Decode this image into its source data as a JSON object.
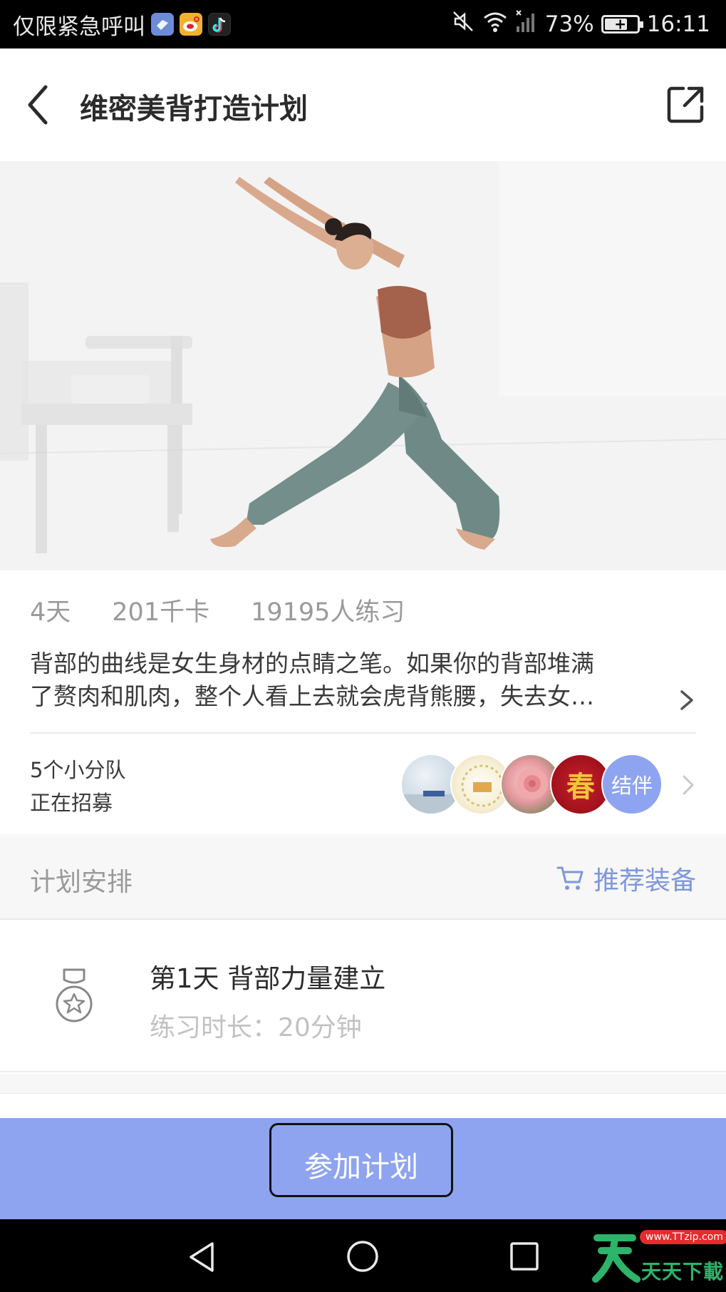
{
  "status_bar": {
    "carrier_text": "仅限紧急呼叫",
    "battery_percent": "73%",
    "battery_level": 0.73,
    "time": "16:11",
    "icons": [
      "blue-app-icon",
      "weibo-icon",
      "tiktok-icon",
      "mute-icon",
      "wifi-icon",
      "signal-icon",
      "battery-icon"
    ]
  },
  "header": {
    "title": "维密美背打造计划",
    "back_icon": "chevron-left-icon",
    "share_icon": "share-icon"
  },
  "hero": {
    "image": "yoga-woman-side-stretch"
  },
  "stats": {
    "days": "4天",
    "calories": "201千卡",
    "participants": "19195人练习"
  },
  "description": {
    "line1": "背部的曲线是女生身材的点睛之笔。如果你的背部堆满",
    "line2": "了赘肉和肌肉，整个人看上去就会虎背熊腰，失去女…"
  },
  "squads": {
    "line1": "5个小分队",
    "line2": "正在招募",
    "avatar4_text": "春",
    "join_partner_label": "结伴"
  },
  "plan": {
    "title": "计划安排",
    "equipment_label": "推荐装备",
    "days": [
      {
        "title": "第1天 背部力量建立",
        "duration": "练习时长：20分钟"
      }
    ]
  },
  "join": {
    "button_label": "参加计划"
  },
  "nav": {
    "watermark_text": "天天下載",
    "watermark_url": "www.TTzip.com"
  },
  "colors": {
    "accent": "#8ea4f0",
    "accent_text": "#7e97dd",
    "muted_text": "#9a9a9a",
    "status_bar_bg": "#000000"
  }
}
